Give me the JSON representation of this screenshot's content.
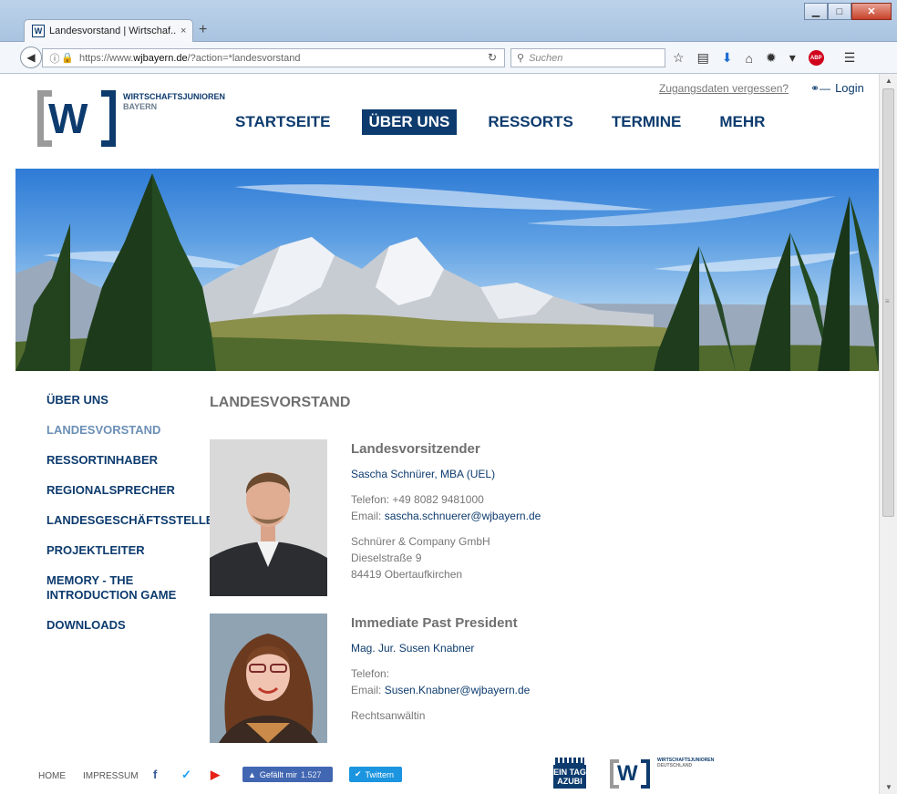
{
  "browser": {
    "tab_title": "Landesvorstand | Wirtschaf...",
    "tab_close": "×",
    "new_tab": "+",
    "favicon_text": "W",
    "url_prefix": "https://www.",
    "url_domain": "wjbayern.de",
    "url_suffix": "/?action=*landesvorstand",
    "search_placeholder": "Suchen",
    "adblock_label": "ABP",
    "window_controls": {
      "minimize": "▁",
      "maximize": "□",
      "close": "✕"
    }
  },
  "header": {
    "logo_letters": "W",
    "brand_name": "WIRTSCHAFTSJUNIOREN",
    "brand_sub": "BAYERN",
    "forgot_link": "Zugangsdaten vergessen?",
    "login_label": "Login",
    "nav": [
      {
        "label": "STARTSEITE",
        "active": false
      },
      {
        "label": "ÜBER UNS",
        "active": true
      },
      {
        "label": "RESSORTS",
        "active": false
      },
      {
        "label": "TERMINE",
        "active": false
      },
      {
        "label": "MEHR",
        "active": false
      }
    ]
  },
  "sidebar": {
    "items": [
      {
        "label": "ÜBER UNS",
        "active": false
      },
      {
        "label": "LANDESVORSTAND",
        "active": true
      },
      {
        "label": "RESSORTINHABER",
        "active": false
      },
      {
        "label": "REGIONALSPRECHER",
        "active": false
      },
      {
        "label": "LANDESGESCHÄFTSSTELLE",
        "active": false
      },
      {
        "label": "PROJEKTLEITER",
        "active": false
      },
      {
        "label": "MEMORY - THE INTRODUCTION GAME",
        "active": false
      },
      {
        "label": "DOWNLOADS",
        "active": false
      }
    ]
  },
  "main": {
    "heading": "LANDESVORSTAND",
    "members": [
      {
        "role": "Landesvorsitzender",
        "name": "Sascha Schnürer, MBA (UEL)",
        "phone": "Telefon: +49 8082 9481000",
        "email_label": "Email: ",
        "email": "sascha.schnuerer@wjbayern.de",
        "company": "Schnürer & Company GmbH",
        "street": "Dieselstraße 9",
        "city": "84419 Obertaufkirchen"
      },
      {
        "role": "Immediate Past President",
        "name": "Mag. Jur. Susen Knabner",
        "phone": "Telefon:",
        "email_label": "Email: ",
        "email": "Susen.Knabner@wjbayern.de",
        "company": "Rechtsanwältin"
      }
    ]
  },
  "footer": {
    "home": "HOME",
    "impressum": "IMPRESSUM",
    "facebook_like": "Gefällt mir",
    "facebook_count": "1.527",
    "twitter_button": "Twittern",
    "eintag_line1": "EIN TAG",
    "eintag_line2": "AZUBI",
    "wjd_letters": "W",
    "wjd_name": "WIRTSCHAFTSJUNIOREN",
    "wjd_sub": "DEUTSCHLAND"
  },
  "colors": {
    "brand_navy": "#0d3b6e",
    "active_sidebar": "#6b8fb5",
    "heading_gray": "#6f6f6f",
    "facebook": "#4267b2",
    "twitter": "#1b95e0",
    "youtube": "#e62117"
  }
}
